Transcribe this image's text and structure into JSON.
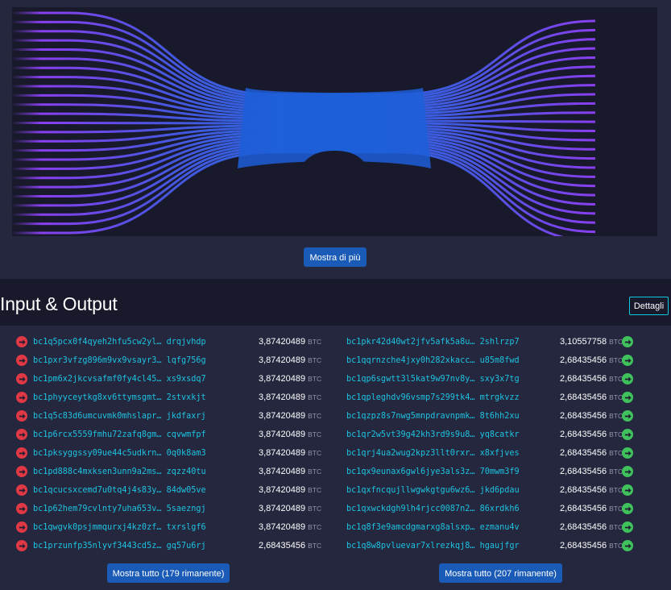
{
  "flow": {
    "more_label": "Mostra di più"
  },
  "io": {
    "title": "Input & Output",
    "details_label": "Dettagli"
  },
  "unit": "BTC",
  "inputs": [
    {
      "addr_start": "bc1q5pcx0f4qyeh2hfu5cw2yl…",
      "addr_end": "drqjvhdp",
      "amount": "3,87420489"
    },
    {
      "addr_start": "bc1pxr3vfzg896m9vx9vsayr3…",
      "addr_end": "lqfg756g",
      "amount": "3,87420489"
    },
    {
      "addr_start": "bc1pm6x2jkcvsafmf0fy4cl45…",
      "addr_end": "xs9xsdq7",
      "amount": "3,87420489"
    },
    {
      "addr_start": "bc1phyyceytkg8xv6ttymsgmt…",
      "addr_end": "2stvxkjt",
      "amount": "3,87420489"
    },
    {
      "addr_start": "bc1q5c83d6umcuvmk0mhslapr…",
      "addr_end": "jkdfaxrj",
      "amount": "3,87420489"
    },
    {
      "addr_start": "bc1p6rcx5559fmhu72zafq8gm…",
      "addr_end": "cqvwmfpf",
      "amount": "3,87420489"
    },
    {
      "addr_start": "bc1pksyggssy09ue44c5udkrn…",
      "addr_end": "0q0k8am3",
      "amount": "3,87420489"
    },
    {
      "addr_start": "bc1pd888c4mxksen3unn9a2ms…",
      "addr_end": "zqzz40tu",
      "amount": "3,87420489"
    },
    {
      "addr_start": "bc1qcucsxcemd7u0tq4j4s83y…",
      "addr_end": "84dw05ve",
      "amount": "3,87420489"
    },
    {
      "addr_start": "bc1p62hem79cvlnty7uha653v…",
      "addr_end": "5saezngj",
      "amount": "3,87420489"
    },
    {
      "addr_start": "bc1qwgvk0psjmmqurxj4kz0zf…",
      "addr_end": "txrslgf6",
      "amount": "3,87420489"
    },
    {
      "addr_start": "bc1przunfp35nlyvf3443cd5z…",
      "addr_end": "gq57u6rj",
      "amount": "2,68435456"
    }
  ],
  "outputs": [
    {
      "addr_start": "bc1pkr42d40wt2jfv5afk5a8u…",
      "addr_end": "2shlrzp7",
      "amount": "3,10557758"
    },
    {
      "addr_start": "bc1qqrnzche4jxy0h282xkacc…",
      "addr_end": "u85m8fwd",
      "amount": "2,68435456"
    },
    {
      "addr_start": "bc1qp6sgwtt3l5kat9w97nv8y…",
      "addr_end": "sxy3x7tg",
      "amount": "2,68435456"
    },
    {
      "addr_start": "bc1qpleghdv96vsmp7s299tk4…",
      "addr_end": "mtrgkvzz",
      "amount": "2,68435456"
    },
    {
      "addr_start": "bc1qzpz8s7nwg5mnpdravnpmk…",
      "addr_end": "8t6hh2xu",
      "amount": "2,68435456"
    },
    {
      "addr_start": "bc1qr2w5vt39g42kh3rd9s9u8…",
      "addr_end": "yq8catkr",
      "amount": "2,68435456"
    },
    {
      "addr_start": "bc1qrj4ua2wug2kpz3llt0rxr…",
      "addr_end": "x8xfjves",
      "amount": "2,68435456"
    },
    {
      "addr_start": "bc1qx9eunax6gwl6jye3als3z…",
      "addr_end": "70mwm3f9",
      "amount": "2,68435456"
    },
    {
      "addr_start": "bc1qxfncqujllwgwkgtgu6wz6…",
      "addr_end": "jkd6pdau",
      "amount": "2,68435456"
    },
    {
      "addr_start": "bc1qxwckdgh9lh4rjcc0087n2…",
      "addr_end": "86xrdkh6",
      "amount": "2,68435456"
    },
    {
      "addr_start": "bc1q8f3e9amcdgmarxg8alsxp…",
      "addr_end": "ezmanu4v",
      "amount": "2,68435456"
    },
    {
      "addr_start": "bc1q8w8pvluevar7xlrezkqj8…",
      "addr_end": "hgaujfgr",
      "amount": "2,68435456"
    }
  ],
  "show_all_inputs": "Mostra tutto (179 rimanente)",
  "show_all_outputs": "Mostra tutto (207 rimanente)",
  "colors": {
    "input_icon": "#e03844",
    "output_icon": "#3fc25b",
    "address": "#1ec3e0",
    "flow_line": "#8a3ff0",
    "flow_center": "#1a6ad8"
  },
  "icons": {
    "input": "arrow-right-circle-icon",
    "output": "arrow-right-circle-icon"
  }
}
